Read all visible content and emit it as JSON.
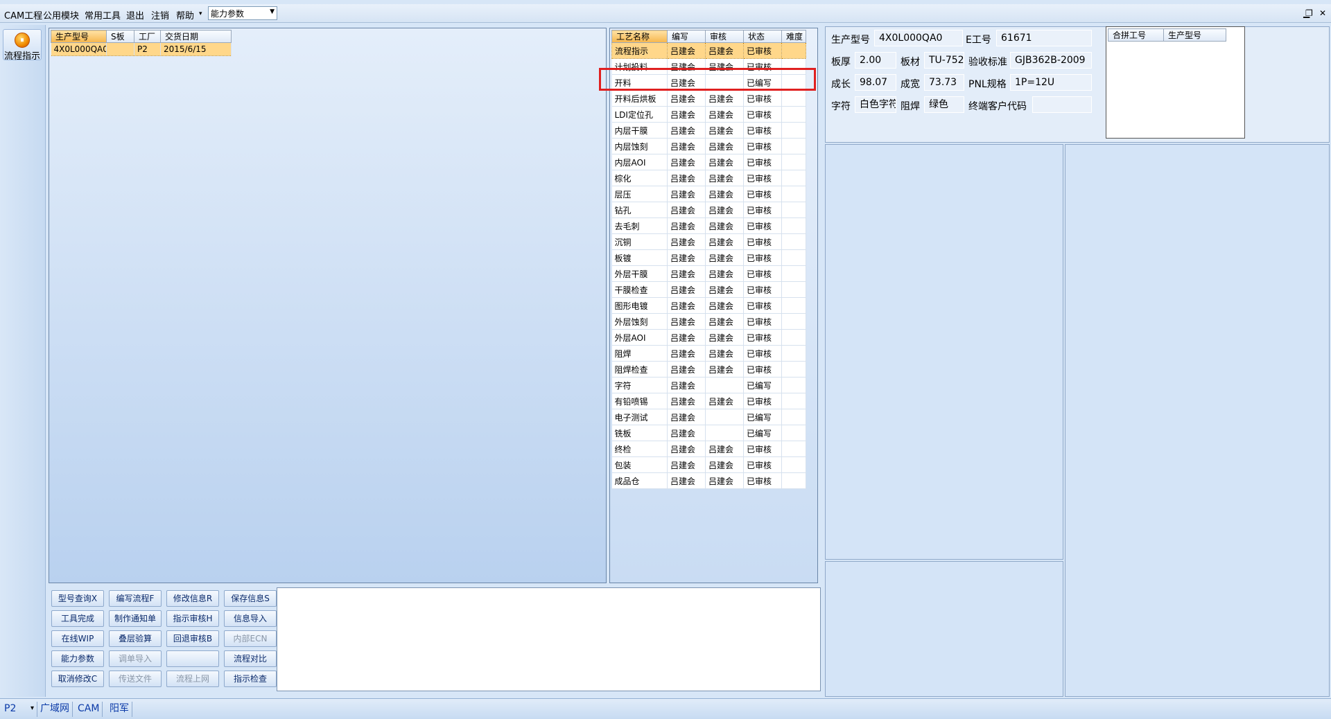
{
  "menubar": {
    "items": [
      "CAM工程",
      "公用模块",
      "常用工具",
      "退出",
      "注销",
      "帮助"
    ],
    "dropdown_arrow": "▾",
    "ability_combo_value": "能力参数"
  },
  "window_controls": {
    "minimize": "▁",
    "restore": "❐",
    "close": "✕"
  },
  "sidebar": {
    "flow_button_label": "流程指示",
    "flow_icon": "record-icon"
  },
  "orders_table": {
    "columns": [
      "生产型号",
      "S板",
      "工厂",
      "交货日期"
    ],
    "rows": [
      {
        "model": "4X0L000QA0",
        "s": "",
        "factory": "P2",
        "date": "2015/6/15"
      }
    ]
  },
  "process_table": {
    "columns": [
      "工艺名称",
      "编写",
      "审核",
      "状态",
      "难度"
    ],
    "rows": [
      {
        "name": "流程指示",
        "writer": "吕建会",
        "reviewer": "吕建会",
        "status": "已审核",
        "difficulty": ""
      },
      {
        "name": "计划投料",
        "writer": "吕建会",
        "reviewer": "吕建会",
        "status": "已审核",
        "difficulty": ""
      },
      {
        "name": "开料",
        "writer": "吕建会",
        "reviewer": "",
        "status": "已编写",
        "difficulty": ""
      },
      {
        "name": "开料后烘板",
        "writer": "吕建会",
        "reviewer": "吕建会",
        "status": "已审核",
        "difficulty": ""
      },
      {
        "name": "LDI定位孔",
        "writer": "吕建会",
        "reviewer": "吕建会",
        "status": "已审核",
        "difficulty": ""
      },
      {
        "name": "内层干膜",
        "writer": "吕建会",
        "reviewer": "吕建会",
        "status": "已审核",
        "difficulty": ""
      },
      {
        "name": "内层蚀刻",
        "writer": "吕建会",
        "reviewer": "吕建会",
        "status": "已审核",
        "difficulty": ""
      },
      {
        "name": "内层AOI",
        "writer": "吕建会",
        "reviewer": "吕建会",
        "status": "已审核",
        "difficulty": ""
      },
      {
        "name": "棕化",
        "writer": "吕建会",
        "reviewer": "吕建会",
        "status": "已审核",
        "difficulty": ""
      },
      {
        "name": "层压",
        "writer": "吕建会",
        "reviewer": "吕建会",
        "status": "已审核",
        "difficulty": ""
      },
      {
        "name": "钻孔",
        "writer": "吕建会",
        "reviewer": "吕建会",
        "status": "已审核",
        "difficulty": ""
      },
      {
        "name": "去毛刺",
        "writer": "吕建会",
        "reviewer": "吕建会",
        "status": "已审核",
        "difficulty": ""
      },
      {
        "name": "沉铜",
        "writer": "吕建会",
        "reviewer": "吕建会",
        "status": "已审核",
        "difficulty": ""
      },
      {
        "name": "板镀",
        "writer": "吕建会",
        "reviewer": "吕建会",
        "status": "已审核",
        "difficulty": ""
      },
      {
        "name": "外层干膜",
        "writer": "吕建会",
        "reviewer": "吕建会",
        "status": "已审核",
        "difficulty": ""
      },
      {
        "name": "干膜检查",
        "writer": "吕建会",
        "reviewer": "吕建会",
        "status": "已审核",
        "difficulty": ""
      },
      {
        "name": "图形电镀",
        "writer": "吕建会",
        "reviewer": "吕建会",
        "status": "已审核",
        "difficulty": ""
      },
      {
        "name": "外层蚀刻",
        "writer": "吕建会",
        "reviewer": "吕建会",
        "status": "已审核",
        "difficulty": ""
      },
      {
        "name": "外层AOI",
        "writer": "吕建会",
        "reviewer": "吕建会",
        "status": "已审核",
        "difficulty": ""
      },
      {
        "name": "阻焊",
        "writer": "吕建会",
        "reviewer": "吕建会",
        "status": "已审核",
        "difficulty": ""
      },
      {
        "name": "阻焊检查",
        "writer": "吕建会",
        "reviewer": "吕建会",
        "status": "已审核",
        "difficulty": ""
      },
      {
        "name": "字符",
        "writer": "吕建会",
        "reviewer": "",
        "status": "已编写",
        "difficulty": ""
      },
      {
        "name": "有铅喷锡",
        "writer": "吕建会",
        "reviewer": "吕建会",
        "status": "已审核",
        "difficulty": ""
      },
      {
        "name": "电子测试",
        "writer": "吕建会",
        "reviewer": "",
        "status": "已编写",
        "difficulty": ""
      },
      {
        "name": "铣板",
        "writer": "吕建会",
        "reviewer": "",
        "status": "已编写",
        "difficulty": ""
      },
      {
        "name": "终检",
        "writer": "吕建会",
        "reviewer": "吕建会",
        "status": "已审核",
        "difficulty": ""
      },
      {
        "name": "包装",
        "writer": "吕建会",
        "reviewer": "吕建会",
        "status": "已审核",
        "difficulty": ""
      },
      {
        "name": "成品仓",
        "writer": "吕建会",
        "reviewer": "吕建会",
        "status": "已审核",
        "difficulty": ""
      }
    ]
  },
  "buttons": [
    [
      {
        "label": "型号查询X",
        "enabled": true
      },
      {
        "label": "编写流程F",
        "enabled": true
      },
      {
        "label": "修改信息R",
        "enabled": true
      },
      {
        "label": "保存信息S",
        "enabled": true
      }
    ],
    [
      {
        "label": "工具完成",
        "enabled": true
      },
      {
        "label": "制作通知单",
        "enabled": true
      },
      {
        "label": "指示审核H",
        "enabled": true
      },
      {
        "label": "信息导入",
        "enabled": true
      }
    ],
    [
      {
        "label": "在线WIP",
        "enabled": true
      },
      {
        "label": "叠层验算",
        "enabled": true
      },
      {
        "label": "回退审核B",
        "enabled": true
      },
      {
        "label": "内部ECN",
        "enabled": false
      }
    ],
    [
      {
        "label": "能力参数",
        "enabled": true
      },
      {
        "label": "调单导入",
        "enabled": false
      },
      {
        "label": "",
        "enabled": false
      },
      {
        "label": "流程对比",
        "enabled": true
      }
    ],
    [
      {
        "label": "取消修改C",
        "enabled": true
      },
      {
        "label": "传送文件",
        "enabled": false
      },
      {
        "label": "流程上网",
        "enabled": false
      },
      {
        "label": "指示检查",
        "enabled": true
      }
    ]
  ],
  "info": {
    "model_label": "生产型号",
    "model_value": "4X0L000QA0",
    "eno_label": "E工号",
    "eno_value": "61671",
    "thickness_label": "板厚",
    "thickness_value": "2.00",
    "material_label": "板材",
    "material_value": "TU-752",
    "standard_label": "验收标准",
    "standard_value": "GJB362B-2009",
    "length_label": "成长",
    "length_value": "98.07",
    "width_label": "成宽",
    "width_value": "73.73",
    "pnl_label": "PNL规格",
    "pnl_value": "1P=12U",
    "char_label": "字符",
    "char_value": "白色字符",
    "mask_label": "阻焊",
    "mask_value": "绿色",
    "customer_label": "终端客户代码",
    "customer_value": ""
  },
  "merge_table": {
    "columns": [
      "合拼工号",
      "生产型号"
    ]
  },
  "statusbar": {
    "factory": "P2",
    "arrow": "▾",
    "items": [
      "广域网",
      "CAM",
      "阳军"
    ]
  }
}
